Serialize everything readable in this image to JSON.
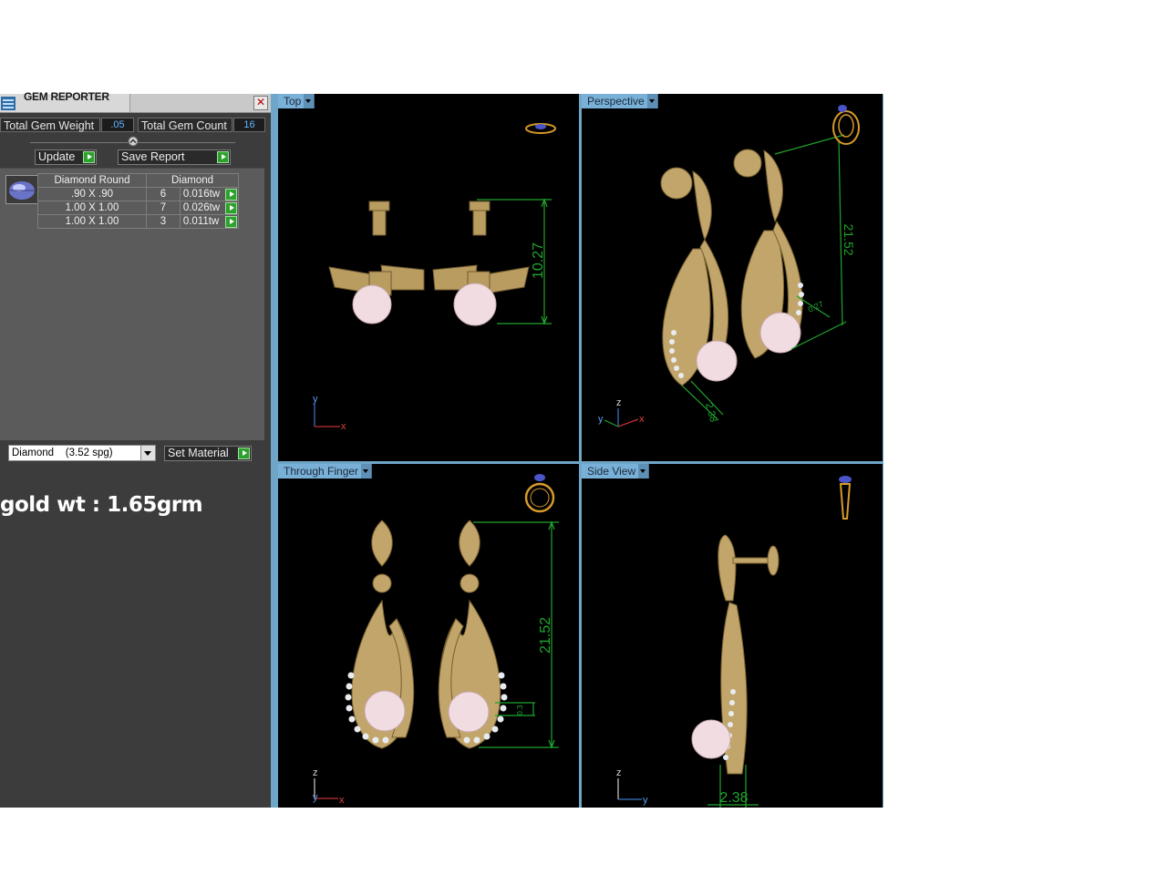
{
  "gem_reporter": {
    "title": "GEM REPORTER",
    "close_glyph": "✕",
    "total_gem_weight_label": "Total Gem Weight",
    "total_gem_weight_value": ".05",
    "total_gem_count_label": "Total Gem Count",
    "total_gem_count_value": "16",
    "update_label": "Update",
    "save_report_label": "Save Report",
    "table": {
      "headers": [
        "Diamond Round",
        "Diamond"
      ],
      "rows": [
        {
          "size": ".90 X .90",
          "count": "6",
          "weight": "0.016tw"
        },
        {
          "size": "1.00 X 1.00",
          "count": "7",
          "weight": "0.026tw"
        },
        {
          "size": "1.00 X 1.00",
          "count": "3",
          "weight": "0.011tw"
        }
      ]
    },
    "material_select": "Diamond    (3.52 spg)",
    "set_material_label": "Set Material"
  },
  "annotation": "gold wt : 1.65grm",
  "viewports": {
    "top": {
      "label": "Top",
      "dimension": "10.27"
    },
    "perspective": {
      "label": "Perspective",
      "dimension": "21.52",
      "dimension_small": "2.38",
      "dimension_tiny": "0.27"
    },
    "through_finger": {
      "label": "Through Finger",
      "dimension": "21.52",
      "dimension_small": "0.3"
    },
    "side_view": {
      "label": "Side View",
      "dimension": "2.38"
    }
  },
  "axes": {
    "x": "x",
    "y": "y",
    "z": "z"
  },
  "colors": {
    "panel_bg": "#3c3c3c",
    "viewport_bg": "#000000",
    "tab_bg": "#79b0d8",
    "dimension": "#1fa52f",
    "gold": "#c9ad73",
    "pearl": "#f3dfe2"
  }
}
